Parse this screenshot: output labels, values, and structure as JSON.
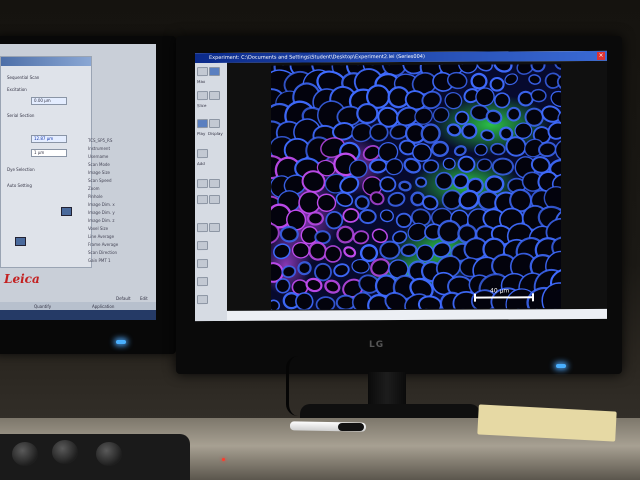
{
  "left_monitor": {
    "brand_logo": "Leica",
    "settings_labels": [
      "Sequential Scan",
      "Excitation",
      "Serial Section",
      "Dye Selection",
      "Auto Setting"
    ],
    "values": [
      "0.00 µm",
      "12.87 µm",
      "1 µm"
    ],
    "list_header": [
      "TCS_SP5_RS",
      "Instrument",
      "Username"
    ],
    "list_rows": [
      "Scan Mode",
      "Image Size",
      "Scan Speed",
      "Zoom",
      "Pinhole",
      "Image Dim. x",
      "Image Dim. y",
      "Image Dim. z",
      "Voxel Size",
      "Line Average",
      "Frame Average",
      "Scan Direction",
      "Gain PMT 1",
      "Gain PMT 2",
      "Gain PMT 3",
      "Gain PMT 4",
      "Offset PMT 1",
      "Offset PMT 2",
      "Pinhole [AU]",
      "Electronic Zoom"
    ],
    "buttons": [
      "Default",
      "Edit"
    ],
    "tabs": [
      "Quantify",
      "Application"
    ]
  },
  "right_monitor": {
    "window_title": "Experiment: C:\\Documents and Settings\\Student\\Desktop\\Experiment2.lei (Series004)",
    "tool_labels": [
      "Max",
      "Slice",
      "Play",
      "Display",
      "Add"
    ],
    "scale_label": "40 µm",
    "brand_logo": "LG"
  },
  "colors": {
    "cell_wall_blue": "#3f6bff",
    "chlorophyll_green": "#31e04a",
    "lignin_magenta": "#c24cf0",
    "led_blue": "#4ab0ff"
  }
}
